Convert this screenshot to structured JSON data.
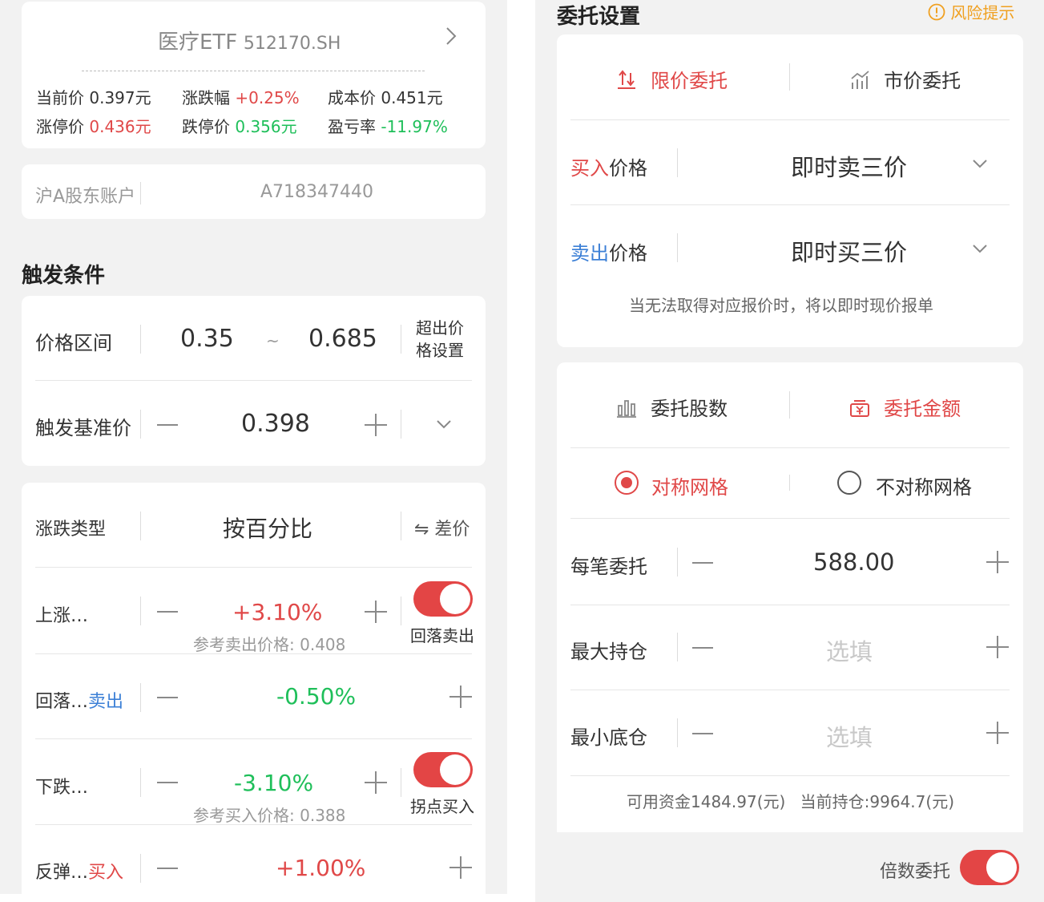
{
  "stock": {
    "name": "医疗ETF",
    "code": "512170.SH",
    "current_label": "当前价",
    "current_value": "0.397元",
    "change_label": "涨跌幅",
    "change_value": "+0.25%",
    "cost_label": "成本价",
    "cost_value": "0.451元",
    "limit_up_label": "涨停价",
    "limit_up_value": "0.436元",
    "limit_down_label": "跌停价",
    "limit_down_value": "0.356元",
    "pnl_label": "盈亏率",
    "pnl_value": "-11.97%"
  },
  "account": {
    "label": "沪A股东账户",
    "value": "A718347440"
  },
  "trigger": {
    "section_title": "触发条件",
    "price_range_label": "价格区间",
    "range_low": "0.35",
    "range_sep": "~",
    "range_high": "0.685",
    "out_of_range_label_1": "超出价",
    "out_of_range_label_2": "格设置",
    "base_price_label": "触发基准价",
    "base_price_value": "0.398"
  },
  "change_type": {
    "label": "涨跌类型",
    "value": "按百分比",
    "switch_label": "⇋ 差价"
  },
  "rise": {
    "label": "上涨…",
    "value": "+3.10%",
    "ref_label": "参考卖出价格:",
    "ref_value": "0.408",
    "toggle_label": "回落卖出",
    "toggle_on": true
  },
  "pullback": {
    "label": "回落…",
    "label_action": "卖出",
    "value": "-0.50%"
  },
  "fall": {
    "label": "下跌…",
    "value": "-3.10%",
    "ref_label": "参考买入价格:",
    "ref_value": "0.388",
    "toggle_label": "拐点买入",
    "toggle_on": true
  },
  "rebound": {
    "label": "反弹…",
    "label_action": "买入",
    "value": "+1.00%"
  },
  "order": {
    "section_title": "委托设置",
    "risk_tip": "风险提示",
    "limit_tab": "限价委托",
    "market_tab": "市价委托",
    "buy_price_prefix": "买入",
    "buy_price_suffix": "价格",
    "buy_price_value": "即时卖三价",
    "sell_price_prefix": "卖出",
    "sell_price_suffix": "价格",
    "sell_price_value": "即时买三价",
    "note": "当无法取得对应报价时，将以即时现价报单"
  },
  "amount": {
    "shares_tab": "委托股数",
    "money_tab": "委托金额",
    "symmetric": "对称网格",
    "asymmetric": "不对称网格",
    "per_order_label": "每笔委托",
    "per_order_value": "588.00",
    "max_hold_label": "最大持仓",
    "max_hold_placeholder": "选填",
    "min_hold_label": "最小底仓",
    "min_hold_placeholder": "选填",
    "available_funds": "可用资金1484.97(元)",
    "current_position": "当前持仓:9964.7(元)",
    "multiple_label": "倍数委托",
    "multiple_on": true
  },
  "colors": {
    "accent_red": "#e04848",
    "up_red": "#e04848",
    "down_green": "#1fbf5a",
    "sell_blue": "#3b7fd6",
    "toggle_red": "#e34545",
    "warning_orange": "#f0a020"
  },
  "icons": [
    "chevron-right-icon",
    "chevron-down-icon",
    "limit-order-icon",
    "market-order-icon",
    "shares-icon",
    "money-icon",
    "warning-icon"
  ]
}
